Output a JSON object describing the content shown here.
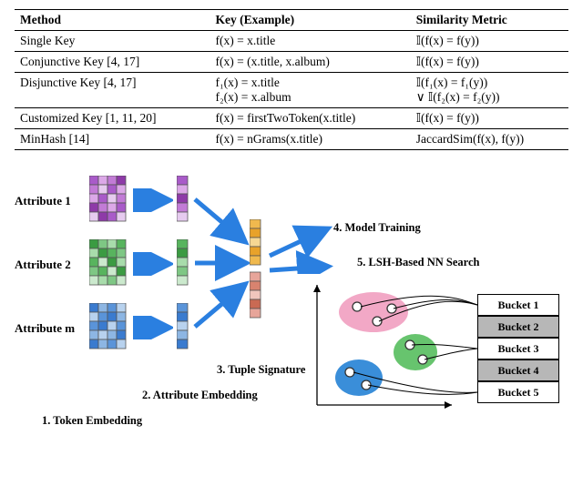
{
  "table": {
    "headers": [
      "Method",
      "Key (Example)",
      "Similarity Metric"
    ],
    "rows": [
      {
        "method": "Single Key",
        "key": "f(x) = x.title",
        "sim": "𝕀(f(x) = f(y))"
      },
      {
        "method": "Conjunctive Key [4, 17]",
        "key": "f(x) = (x.title, x.album)",
        "sim": "𝕀(f(x) = f(y))"
      },
      {
        "method": "Disjunctive Key [4, 17]",
        "key": "f₁(x) = x.title\nf₂(x) = x.album",
        "sim": "𝕀(f₁(x) = f₁(y))\n∨ 𝕀(f₂(x) = f₂(y))"
      },
      {
        "method": "Customized Key [1, 11, 20]",
        "key": "f(x) = firstTwoToken(x.title)",
        "sim": "𝕀(f(x) = f(y))"
      },
      {
        "method": "MinHash [14]",
        "key": "f(x) = nGrams(x.title)",
        "sim": "JaccardSim(f(x), f(y))"
      }
    ]
  },
  "figure": {
    "attributes": [
      "Attribute 1",
      "Attribute 2",
      "Attribute m"
    ],
    "steps": {
      "s1": "1. Token Embedding",
      "s2": "2. Attribute Embedding",
      "s3": "3. Tuple Signature",
      "s4": "4. Model Training",
      "s5": "5. LSH-Based NN Search"
    },
    "buckets": [
      "Bucket 1",
      "Bucket 2",
      "Bucket 3",
      "Bucket 4",
      "Bucket 5"
    ]
  }
}
